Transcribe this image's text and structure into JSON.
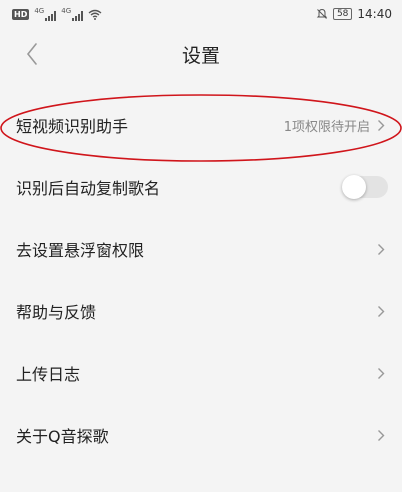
{
  "status_bar": {
    "hd_badge": "HD",
    "net1": "4G",
    "net2": "4G",
    "battery": "58",
    "time": "14:40"
  },
  "header": {
    "title": "设置"
  },
  "settings": [
    {
      "label": "短视频识别助手",
      "value": "1项权限待开启",
      "control": "chevron"
    },
    {
      "label": "识别后自动复制歌名",
      "control": "toggle",
      "toggle_on": false
    },
    {
      "label": "去设置悬浮窗权限",
      "control": "chevron"
    },
    {
      "label": "帮助与反馈",
      "control": "chevron"
    },
    {
      "label": "上传日志",
      "control": "chevron"
    },
    {
      "label": "关于Q音探歌",
      "control": "chevron"
    }
  ],
  "colors": {
    "background": "#f4f4f4",
    "annotation": "#d0151b",
    "toggle_off": "#e3e3e3"
  },
  "icons": [
    "back-arrow-icon",
    "chevron-right-icon",
    "signal-icon",
    "wifi-icon",
    "mute-icon"
  ]
}
